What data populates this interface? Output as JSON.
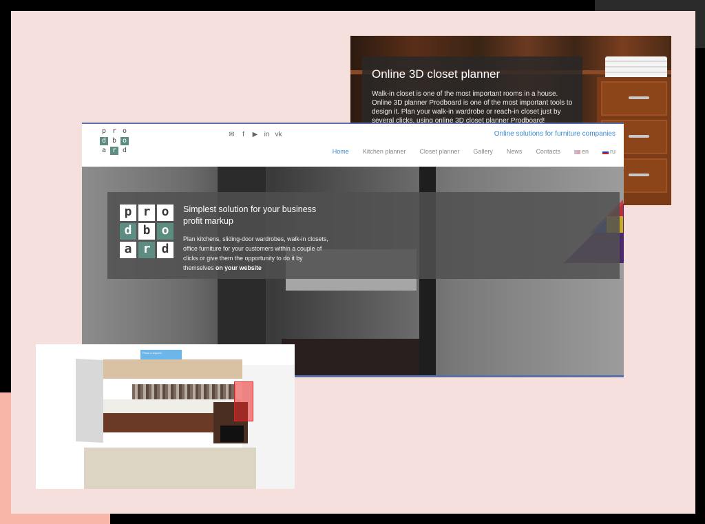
{
  "closet": {
    "title": "Online 3D closet planner",
    "text": "Walk-in closet is one of the most important rooms in a house. Online 3D planner Prodboard is one of the most important tools to design it. Plan your walk-in wardrobe or reach-in closet just by several clicks, using online 3D closet planner Prodboard!"
  },
  "site": {
    "logo": {
      "row1": [
        "p",
        "r",
        "o"
      ],
      "row2": [
        "d",
        "b",
        "o"
      ],
      "row3": [
        "a",
        "r",
        "d"
      ]
    },
    "socials": [
      "✉",
      "f",
      "▶",
      "in",
      "vk"
    ],
    "social_icons": [
      "mail-icon",
      "facebook-icon",
      "youtube-icon",
      "linkedin-icon",
      "vk-icon"
    ],
    "tagline": "Online solutions for furniture companies",
    "nav": [
      {
        "label": "Home"
      },
      {
        "label": "Kitchen planner"
      },
      {
        "label": "Closet planner"
      },
      {
        "label": "Gallery"
      },
      {
        "label": "News"
      },
      {
        "label": "Contacts"
      },
      {
        "label": "en"
      },
      {
        "label": "ru"
      }
    ],
    "hero": {
      "title": "Simplest solution for your business profit markup",
      "text_prefix": "Plan kitchens, sliding-door wardrobes, walk-in closets, office furniture for your customers within a couple of clicks or give them the opportunity to do it by themselves",
      "text_bold": "on your website"
    }
  },
  "kitchen": {
    "badge": "Place a request"
  },
  "colors": {
    "accent_blue": "#3b8ad1",
    "logo_teal": "#5c8c82",
    "page_pink": "#f6e0de"
  }
}
